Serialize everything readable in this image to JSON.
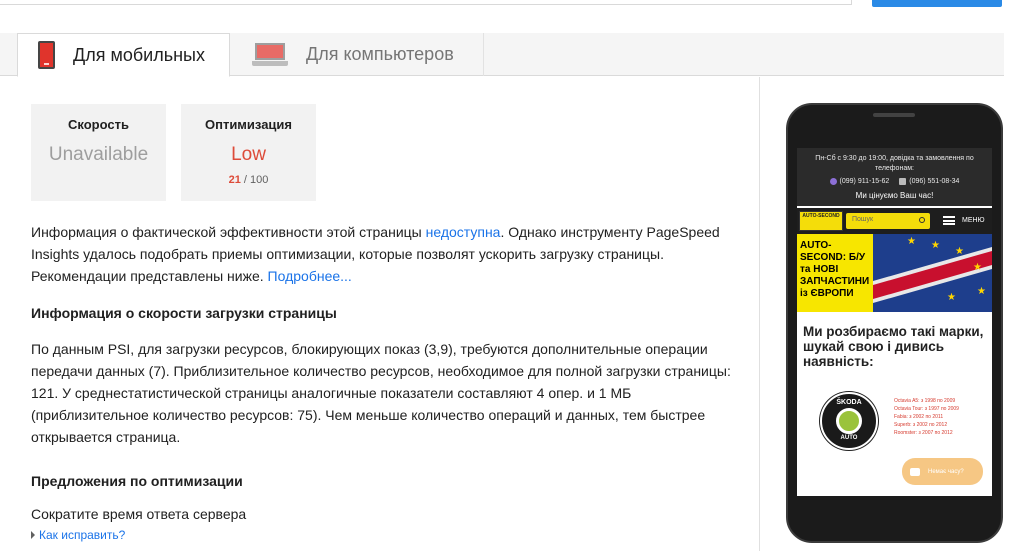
{
  "tabs": [
    {
      "label": "Для мобильных",
      "active": true,
      "icon": "mobile-phone-icon"
    },
    {
      "label": "Для компьютеров",
      "active": false,
      "icon": "desktop-monitor-icon"
    }
  ],
  "cards": {
    "speed": {
      "title": "Скорость",
      "value": "Unavailable"
    },
    "optimization": {
      "title": "Оптимизация",
      "value": "Low",
      "score": "21",
      "max": "/ 100"
    }
  },
  "intro": {
    "text1": "Информация о фактической эффективности этой страницы ",
    "link1": "недоступна",
    "text2": ". Однако инструменту PageSpeed Insights удалось подобрать приемы оптимизации, которые позволят ускорить загрузку страницы. Рекомендации представлены ниже. ",
    "link2": "Подробнее..."
  },
  "speed_section": {
    "heading": "Информация о скорости загрузки страницы",
    "text": "По данным PSI, для загрузки ресурсов, блокирующих показ (3,9), требуются дополнительные операции передачи данных (7). Приблизительное количество ресурсов, необходимое для полной загрузки страницы: 121. У среднестатистической страницы аналогичные показатели составляют 4 опер. и 1 МБ (приблизительное количество ресурсов: 75). Чем меньше количество операций и данных, тем быстрее открывается страница."
  },
  "suggestions": {
    "heading": "Предложения по оптимизации",
    "item": "Сократите время ответа сервера",
    "fix_link": "Как исправить?"
  },
  "preview": {
    "hours": "Пн-Сб с 9:30 до 19:00, довідка та замовлення по телефонам:",
    "phone1": "(099) 911-15-62",
    "phone2": "(096) 551-08-34",
    "slogan": "Ми цінуємо Ваш час!",
    "logo": "AUTO-SECOND",
    "search_placeholder": "Пошук",
    "menu": "МЕНЮ",
    "banner": "AUTO-SECOND: Б/У та НОВІ ЗАПЧАСТИНИ із ЄВРОПИ",
    "heading": "Ми розбираємо такі марки, шукай свою і дивись наявність:",
    "brand_top": "ŠKODA",
    "brand_bottom": "AUTO",
    "models": [
      "Octavia A5: з 1998 по 2009",
      "Octavia Tour: з 1997 по 2009",
      "Fabia: з 2002 по 2011",
      "Superb: з 2002 по 2012",
      "Roomster: з 2007 по 2012"
    ],
    "chat": "Немає часу?"
  },
  "colors": {
    "accent": "#1a73e8",
    "low_score": "#dd4b39",
    "top_button": "#2a8ae6"
  }
}
